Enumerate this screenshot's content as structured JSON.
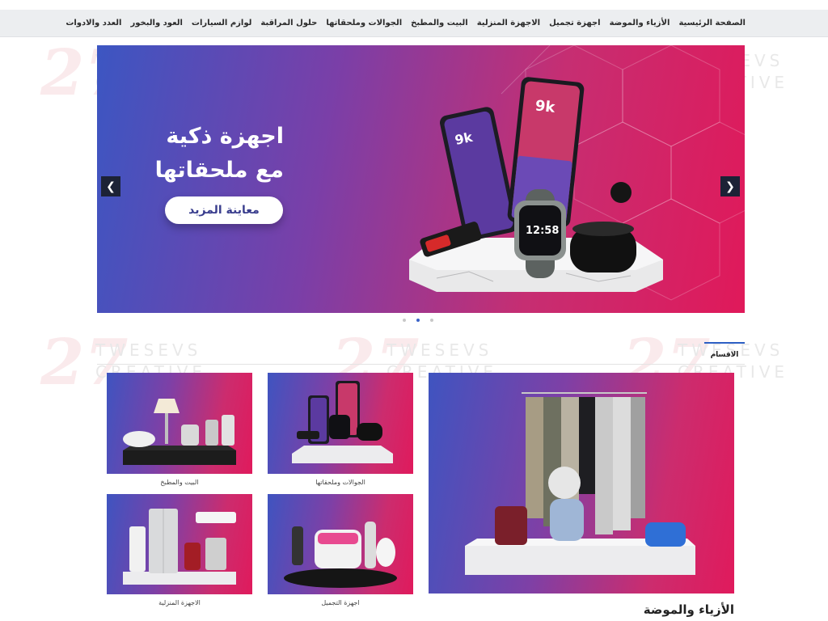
{
  "nav": {
    "items": [
      "الصفحة الرئيسية",
      "الأزياء والموضة",
      "اجهزة تجميل",
      "الاجهزة المنزلية",
      "البيت والمطبخ",
      "الجوالات وملحقاتها",
      "حلول المراقبة",
      "لوازم السيارات",
      "العود والبخور",
      "العدد والادوات"
    ]
  },
  "watermark": {
    "mark": "27",
    "line1": "TWESEVS",
    "line2": "CREATIVE"
  },
  "hero": {
    "line1": "اجهزة ذكية",
    "line2": "مع ملحقاتها",
    "button": "معاينة المزيد",
    "phone_a_text": "9k",
    "phone_b_text": "9k",
    "watch_time": "12:58",
    "slide_count": 3,
    "active_slide": 2
  },
  "sections": {
    "tab_label": "الاقسام",
    "featured_title": "الأزياء والموضة",
    "cards": [
      {
        "caption": "الجوالات وملحقاتها"
      },
      {
        "caption": "البيت والمطبخ"
      },
      {
        "caption": "اجهزة التجميل"
      },
      {
        "caption": "الاجهزة المنزلية"
      }
    ]
  },
  "colors": {
    "accent": "#2d5fc4",
    "gradient_start": "#3c56c2",
    "gradient_end": "#e0195a",
    "nav_bg": "#eceef0"
  },
  "icons": {
    "prev": "chevron-left-icon",
    "next": "chevron-right-icon"
  }
}
